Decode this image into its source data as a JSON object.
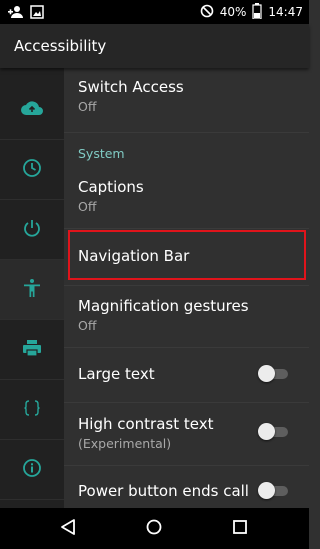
{
  "status_bar": {
    "battery": "40%",
    "time": "14:47",
    "icons": [
      "person-add-icon",
      "image-icon",
      "do-not-disturb-icon",
      "battery-icon"
    ]
  },
  "app_bar": {
    "title": "Accessibility"
  },
  "side_rail": {
    "accent_color": "#26a69a",
    "icons": [
      "cloud-upload-icon",
      "clock-icon",
      "power-icon",
      "accessibility-icon",
      "print-icon",
      "developer-braces-icon",
      "info-icon"
    ],
    "active_index": 3
  },
  "settings": {
    "switch_access": {
      "title": "Switch Access",
      "summary": "Off"
    },
    "system_header": "System",
    "captions": {
      "title": "Captions",
      "summary": "Off"
    },
    "navigation_bar": {
      "title": "Navigation Bar"
    },
    "magnification": {
      "title": "Magnification gestures",
      "summary": "Off"
    },
    "large_text": {
      "title": "Large text",
      "enabled": false
    },
    "high_contrast": {
      "title": "High contrast text",
      "summary": "(Experimental)",
      "enabled": false
    },
    "power_button": {
      "title": "Power button ends call",
      "enabled": false
    }
  },
  "highlight_color": "#e0141b",
  "nav_bar": {
    "icons": [
      "back-icon",
      "home-icon",
      "recents-icon"
    ]
  }
}
